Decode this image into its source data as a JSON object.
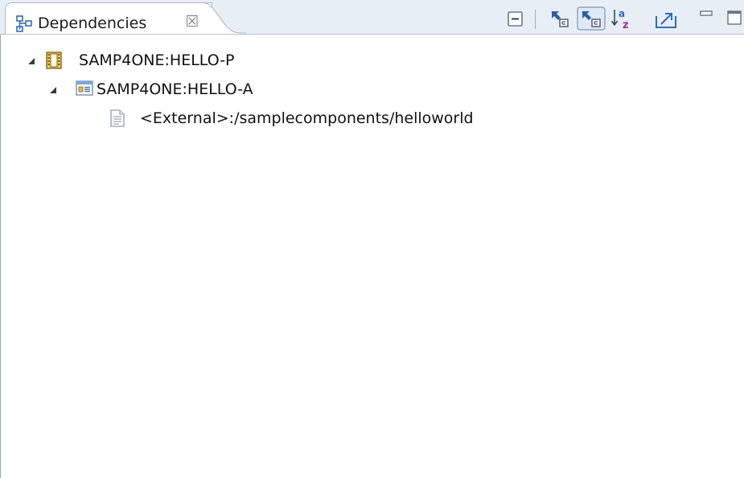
{
  "view": {
    "tab_title": "Dependencies",
    "close_symbol": "☒",
    "icon": "dependencies-view-icon"
  },
  "toolbar": [
    {
      "name": "collapse-all-button",
      "icon": "collapse-all-icon"
    },
    {
      "name": "show-callers-button",
      "icon": "show-callers-icon"
    },
    {
      "name": "show-callees-button",
      "icon": "show-callees-icon",
      "pressed": true
    },
    {
      "name": "sort-alphabetically-button",
      "icon": "sort-az-icon"
    },
    {
      "name": "export-button",
      "icon": "export-icon"
    },
    {
      "name": "minimize-button",
      "icon": "minimize-icon"
    },
    {
      "name": "maximize-button",
      "icon": "maximize-icon"
    }
  ],
  "tree": [
    {
      "label": "SAMP4ONE:HELLO-P",
      "icon": "program-icon",
      "expanded": true,
      "level": 0
    },
    {
      "label": "SAMP4ONE:HELLO-A",
      "icon": "application-icon",
      "expanded": true,
      "level": 1
    },
    {
      "label": "<External>:/samplecomponents/helloworld",
      "icon": "file-icon",
      "expanded": false,
      "level": 2
    }
  ],
  "colors": {
    "tabbar_bg": "#e8eef6",
    "border": "#a9b6c8",
    "icon_blue": "#2f6db5",
    "icon_gold": "#c89a22"
  }
}
